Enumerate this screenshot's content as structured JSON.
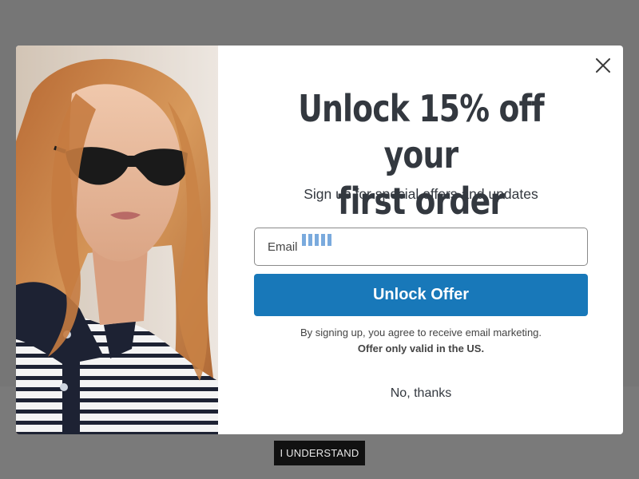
{
  "popup": {
    "headline_line1": "Unlock 15% off your",
    "headline_line2": "first order",
    "subheadline": "Sign up for special offers and updates",
    "email_label": "Email",
    "submit_label": "Unlock Offer",
    "legal_line1": "By signing up, you agree to receive email marketing.",
    "legal_line2": "Offer only valid in the US.",
    "decline_label": "No, thanks",
    "close_icon": "close-icon",
    "accent_color": "#1878b9"
  },
  "cookie_banner": {
    "button_label": "I UNDERSTAND"
  }
}
